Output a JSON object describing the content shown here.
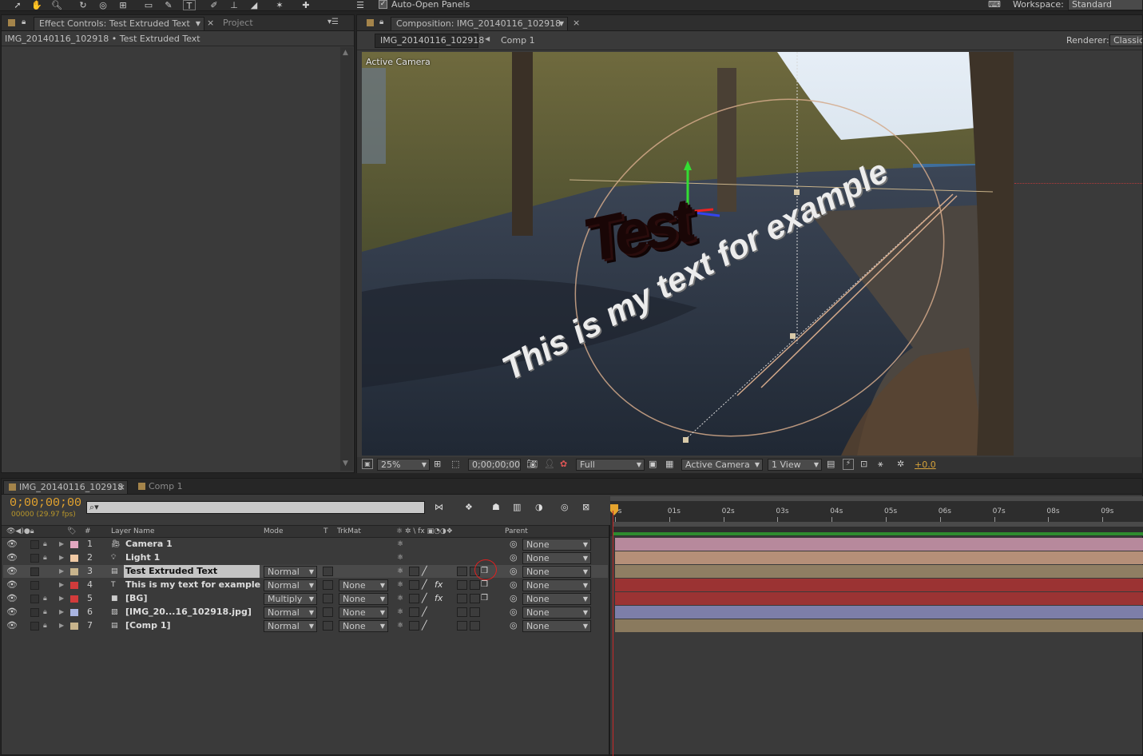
{
  "toolbar": {
    "auto_open_panels": "Auto-Open Panels",
    "workspace_label": "Workspace:",
    "workspace_value": "Standard"
  },
  "effect_panel": {
    "tab_active": "Effect Controls: Test Extruded Text",
    "tab_project": "Project",
    "breadcrumb": "IMG_20140116_102918 • Test Extruded Text"
  },
  "comp_panel": {
    "tab": "Composition: IMG_20140116_102918",
    "nav_current": "IMG_20140116_102918",
    "nav_next": "Comp 1",
    "renderer_label": "Renderer:",
    "renderer_value": "Classic",
    "viewer_label": "Active Camera",
    "overlay_text_1": "Test",
    "overlay_text_2": "This is my text for example",
    "footer": {
      "zoom": "25%",
      "timecode": "0;00;00;00",
      "resolution": "Full",
      "view": "Active Camera",
      "views": "1 View",
      "exposure": "+0.0"
    }
  },
  "timeline": {
    "tab_active": "IMG_20140116_102918",
    "tab_other": "Comp 1",
    "timecode": "0;00;00;00",
    "frame_info": "00000 (29.97 fps)",
    "columns": {
      "num": "#",
      "layer_name": "Layer Name",
      "mode": "Mode",
      "t": "T",
      "trkmat": "TrkMat",
      "parent": "Parent"
    },
    "ruler": [
      "0s",
      "01s",
      "02s",
      "03s",
      "04s",
      "05s",
      "06s",
      "07s",
      "08s",
      "09s"
    ],
    "layers": [
      {
        "num": "1",
        "name": "Camera 1",
        "mode": "",
        "trkmat": "",
        "parent": "None",
        "label_color": "#e3a7c0",
        "bar_color": "#b7899c",
        "icon": "camera-icon",
        "locked": true
      },
      {
        "num": "2",
        "name": "Light 1",
        "mode": "",
        "trkmat": "",
        "parent": "None",
        "label_color": "#f0c9a4",
        "bar_color": "#b58f78",
        "icon": "light-bulb-icon",
        "locked": true
      },
      {
        "num": "3",
        "name": "Test Extruded Text",
        "mode": "Normal",
        "trkmat": "",
        "parent": "None",
        "label_color": "#c8b48c",
        "bar_color": "#8f7e63",
        "icon": "text-layer-icon",
        "locked": false
      },
      {
        "num": "4",
        "name": "This is my text for example",
        "mode": "Normal",
        "trkmat": "None",
        "parent": "None",
        "label_color": "#d23b3b",
        "bar_color": "#9b3333",
        "icon": "text-T-icon",
        "locked": false
      },
      {
        "num": "5",
        "name": "[BG]",
        "mode": "Multiply",
        "trkmat": "None",
        "parent": "None",
        "label_color": "#d23b3b",
        "bar_color": "#9b3333",
        "icon": "solid-icon",
        "locked": true
      },
      {
        "num": "6",
        "name": "[IMG_20...16_102918.jpg]",
        "mode": "Normal",
        "trkmat": "None",
        "parent": "None",
        "label_color": "#a9b4e0",
        "bar_color": "#7d7ea8",
        "icon": "image-file-icon",
        "locked": true
      },
      {
        "num": "7",
        "name": "[Comp 1]",
        "mode": "Normal",
        "trkmat": "None",
        "parent": "None",
        "label_color": "#c8b48c",
        "bar_color": "#8a7a5e",
        "icon": "composition-icon",
        "locked": true
      }
    ]
  }
}
